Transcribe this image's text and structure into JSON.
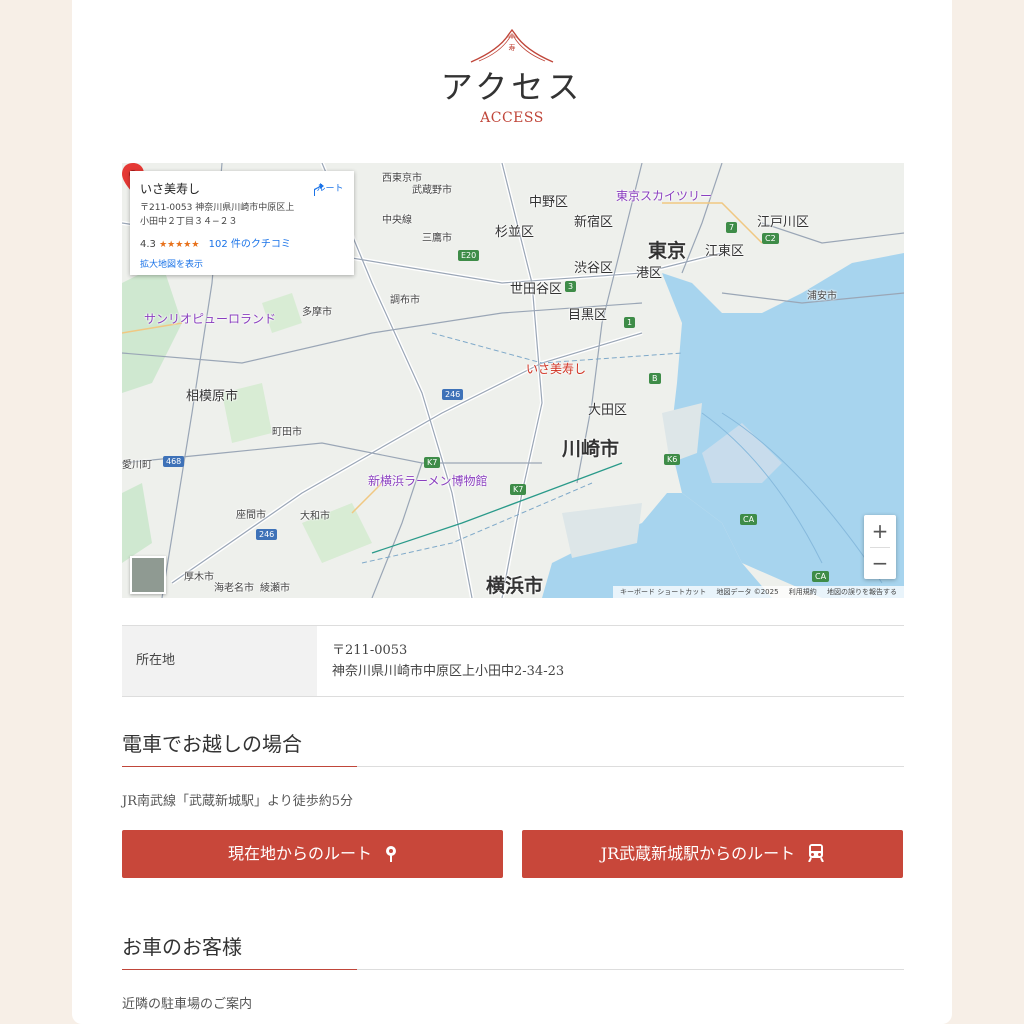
{
  "header": {
    "title_jp": "アクセス",
    "title_en": "ACCESS"
  },
  "map": {
    "infobox": {
      "name": "いさ美寿し",
      "address": "〒211-0053 神奈川県川崎市中原区上小田中２丁目３４−２３",
      "rating": "4.3",
      "stars": "★★★★★",
      "reviews": "102 件のクチコミ",
      "large_map": "拡大地図を表示",
      "route": "ルート"
    },
    "marker_label": "いさ美寿し",
    "labels": {
      "tokyo": "東京",
      "kawasaki": "川崎市",
      "yokohama": "横浜市",
      "sagamihara": "相模原市",
      "nakano": "中野区",
      "shinjuku": "新宿区",
      "suginami": "杉並区",
      "shibuya": "渋谷区",
      "minato": "港区",
      "setagaya": "世田谷区",
      "meguro": "目黒区",
      "ota": "大田区",
      "koto": "江東区",
      "edogawa": "江戸川区",
      "urayasu": "浦安市",
      "nishitokyo": "西東京市",
      "musashino": "武蔵野市",
      "chuo": "中央線",
      "mitaka": "三鷹市",
      "chofu": "調布市",
      "tama": "多摩市",
      "machida": "町田市",
      "yamato": "大和市",
      "zama": "座間市",
      "aikawa": "愛川町",
      "atsugi": "厚木市",
      "ebina": "海老名市",
      "ayase": "綾瀬市",
      "skytree": "東京スカイツリー",
      "sanrio": "サンリオピューロランド",
      "ramen": "新横浜ラーメン博物館"
    },
    "zoom_in": "+",
    "zoom_out": "−",
    "attribution": [
      "キーボード ショートカット",
      "地図データ ©2025",
      "利用規約",
      "地図の誤りを報告する"
    ]
  },
  "address_table": {
    "label": "所在地",
    "postal": "〒211-0053",
    "address": "神奈川県川崎市中原区上小田中2-34-23"
  },
  "train": {
    "heading": "電車でお越しの場合",
    "text": "JR南武線「武蔵新城駅」より徒歩約5分",
    "button_current": "現在地からのルート",
    "button_station": "JR武蔵新城駅からのルート"
  },
  "car": {
    "heading": "お車のお客様",
    "text": "近隣の駐車場のご案内"
  },
  "colors": {
    "accent": "#c0463a",
    "button": "#c8473a",
    "background": "#f7efe7",
    "water": "#a7d4ee"
  },
  "icons": [
    "mountain-logo-icon",
    "route-icon",
    "map-pin-icon",
    "location-pin-icon",
    "train-icon"
  ]
}
